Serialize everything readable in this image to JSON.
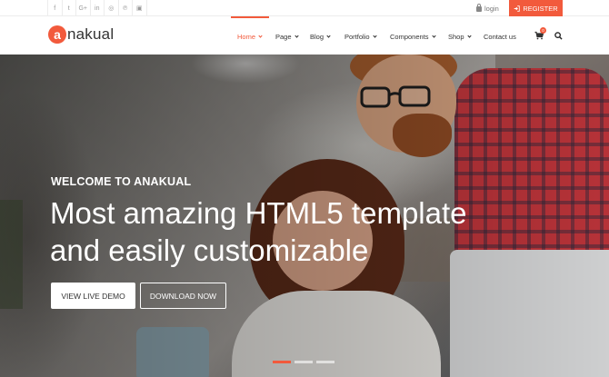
{
  "topbar": {
    "social_icons": [
      "facebook-icon",
      "twitter-icon",
      "google-plus-icon",
      "linkedin-icon",
      "dribbble-icon",
      "pinterest-icon",
      "instagram-icon"
    ],
    "social_glyphs": [
      "f",
      "t",
      "G+",
      "in",
      "◎",
      "℗",
      "▣"
    ],
    "login_label": "login",
    "register_label": "REGISTER"
  },
  "header": {
    "logo_mark": "a",
    "logo_text": "nakual",
    "nav": [
      {
        "label": "Home",
        "active": true
      },
      {
        "label": "Page",
        "active": false
      },
      {
        "label": "Blog",
        "active": false
      },
      {
        "label": "Portfolio",
        "active": false
      },
      {
        "label": "Components",
        "active": false
      },
      {
        "label": "Shop",
        "active": false
      },
      {
        "label": "Contact us",
        "active": false
      }
    ],
    "cart_count": "0"
  },
  "hero": {
    "eyebrow": "WELCOME TO ANAKUAL",
    "headline_line1": "Most amazing HTML5 template",
    "headline_line2": "and easily customizable",
    "primary_button": "VIEW LIVE DEMO",
    "secondary_button": "DOWNLOAD NOW",
    "slides": 3,
    "active_slide": 1
  },
  "colors": {
    "accent": "#f25a3c",
    "text": "#333333"
  }
}
